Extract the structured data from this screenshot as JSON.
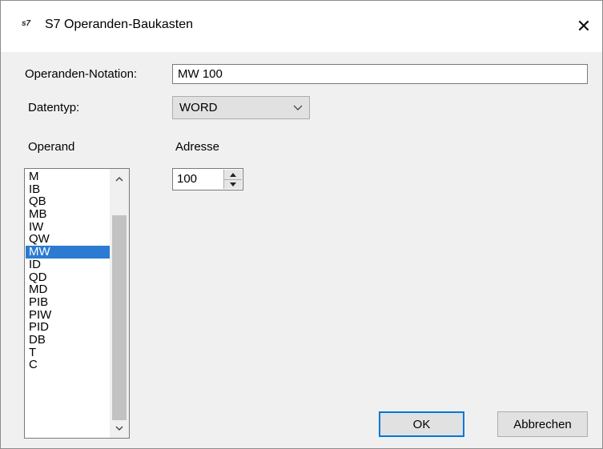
{
  "window": {
    "app_icon": "s7",
    "title": "S7 Operanden-Baukasten",
    "close_glyph": "✕"
  },
  "form": {
    "notation_label": "Operanden-Notation:",
    "notation_value": "MW 100",
    "datatype_label": "Datentyp:",
    "datatype_value": "WORD",
    "operand_label": "Operand",
    "address_label": "Adresse",
    "address_value": "100"
  },
  "operand_list": {
    "items": [
      "M",
      "IB",
      "QB",
      "MB",
      "IW",
      "QW",
      "MW",
      "ID",
      "QD",
      "MD",
      "PIB",
      "PIW",
      "PID",
      "DB",
      "T",
      "C"
    ],
    "selected": "MW",
    "scroll_position_fraction": 0.17
  },
  "buttons": {
    "ok": "OK",
    "cancel": "Abbrechen"
  },
  "colors": {
    "selection": "#2a7bd1",
    "default_button_border": "#0078d7",
    "dialog_background": "#f0f0f0"
  },
  "icons": {
    "app": "s7-icon",
    "close": "close-icon",
    "combo": "chevron-down-icon",
    "scroll_up": "arrow-up-icon",
    "scroll_down": "arrow-down-icon",
    "spin_up": "spin-up-icon",
    "spin_down": "spin-down-icon"
  }
}
